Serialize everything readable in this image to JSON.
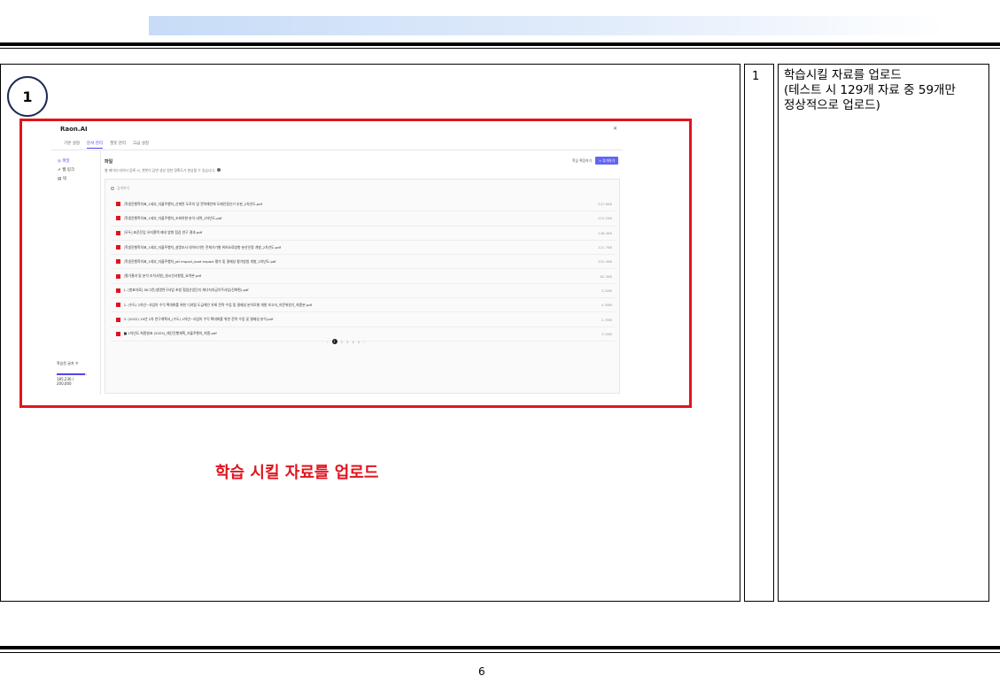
{
  "content": {
    "step_number": "1",
    "caption": "학습 시킬 자료를 업로드"
  },
  "table": {
    "row_number": "1",
    "description_lines": [
      "학습시킬 자료를 업로드",
      "(테스트 시 129개 자료 중 59개만",
      "정상적으로 업로드)"
    ]
  },
  "screenshot": {
    "app_title": "Raon.AI",
    "tabs": [
      "기본 설정",
      "문서 관리",
      "챗봇 관리",
      "고급 설정"
    ],
    "active_tab": 1,
    "sidebar": [
      "파일",
      "웹 링크",
      "텍",
      "학습된 글자 수"
    ],
    "quota_value": "185,236 / 200,000",
    "quota_fraction": 0.93,
    "section_title": "파일",
    "section_desc": "웹 페이지 데이터 등록 시, 챗봇이 답변 생성 원천 정확도가 향상될 수 있습니다.",
    "link_button": "학습 확장하기",
    "add_button": "+ 추가하기",
    "search_placeholder": "검색하기",
    "files": [
      {
        "name": "[학생진행학의표_1세부_자율주행차_산재된 도로의 및 전역체반에 도메인정신기 부분_2차년도.pdf",
        "size": "247.6KB"
      },
      {
        "name": "[학생진행학의표_1세부_자율주행차_조회하향 분석 내역_2차년도.pdf",
        "size": "213.2KB"
      },
      {
        "name": "[모두] 표준진입 유지철택 제내 방향 점검 연구 결과.pdf",
        "size": "146.4KB"
      },
      {
        "name": "[학생진행학의표_1세부_자율주행차_설명조사 데이터기반 전체가기별 위하요료방향 분산인정 개발_2차년도.pdf",
        "size": "121.7KB"
      },
      {
        "name": "[학생진행학의표_1세부_자율주행차_ptl impact_load impact 평가 및 결제성 평가방법 개발_2차년도.pdf",
        "size": "352.4KB"
      },
      {
        "name": "[평가결과 및 분석 조치사항]_설시선사항법_요약본.pdf",
        "size": "82.3KB"
      },
      {
        "name": "1. [발표자료] SK그린(생명연구사업 초청 협업산업단지 재너지자금이주사업(진화편).pdf",
        "size": "3.2MB"
      },
      {
        "name": "2. (수도) 2차년~사업의 수익 확대화를 위한 디지털 도급체인 자체 전략 수립 및 결제성 분석모형 개발 보고서_자문위원기_최종본.pdf",
        "size": "4.3MB"
      },
      {
        "name": "3. (2022) 19년 2차 연구계획서_(수도) 2차년~사업의 수익 확대화를 위한 전략 수립 및 결제성 분석.pdf",
        "size": "2.7MB"
      },
      {
        "name": "■ 2차년도 최종발표 (2023)_재단진행계획_자율주행차_최종.pdf",
        "size": "3.1MB"
      }
    ],
    "pages": [
      "‹",
      "1",
      "2",
      "3",
      "4",
      "5",
      "›"
    ],
    "current_page": "1"
  },
  "footer": {
    "page_number": "6"
  }
}
